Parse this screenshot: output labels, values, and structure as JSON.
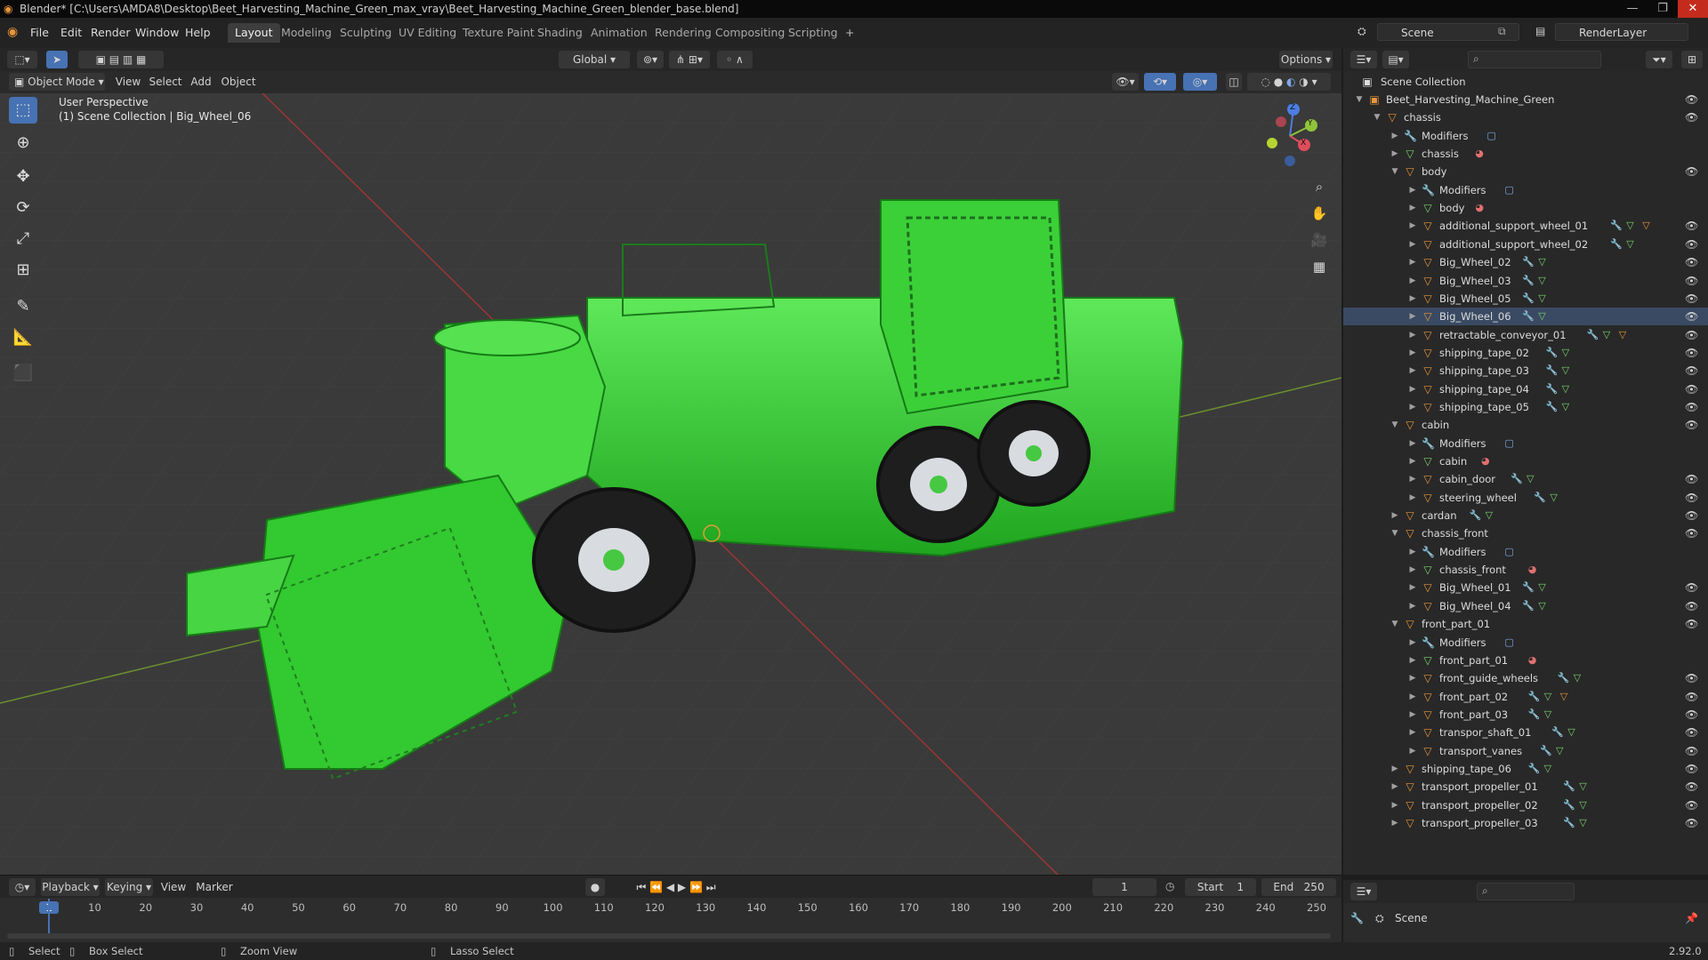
{
  "title_bar": {
    "text": "Blender* [C:\\Users\\AMDA8\\Desktop\\Beet_Harvesting_Machine_Green_max_vray\\Beet_Harvesting_Machine_Green_blender_base.blend]"
  },
  "menus": [
    "File",
    "Edit",
    "Render",
    "Window",
    "Help"
  ],
  "workspaces": [
    "Layout",
    "Modeling",
    "Sculpting",
    "UV Editing",
    "Texture Paint",
    "Shading",
    "Animation",
    "Rendering",
    "Compositing",
    "Scripting"
  ],
  "active_workspace": "Layout",
  "scene_field": "Scene",
  "renderlayer_field": "RenderLayer",
  "header": {
    "transform": "Global",
    "options": "Options"
  },
  "viewport_header": {
    "mode": "Object Mode",
    "items": [
      "View",
      "Select",
      "Add",
      "Object"
    ]
  },
  "viewport": {
    "perspective": "User Perspective",
    "collection": "(1) Scene Collection | Big_Wheel_06",
    "gizmo": {
      "x": "X",
      "y": "Y",
      "z": "Z"
    }
  },
  "outliner": {
    "root": "Scene Collection",
    "rows": [
      {
        "label": "Beet_Harvesting_Machine_Green",
        "depth": 1,
        "icon": "collection",
        "open": true,
        "eye": true
      },
      {
        "label": "chassis",
        "depth": 2,
        "icon": "object",
        "open": true,
        "eye": true
      },
      {
        "label": "Modifiers",
        "depth": 3,
        "icon": "modifier",
        "open": false,
        "eye": false,
        "extra": [
          "mod"
        ]
      },
      {
        "label": "chassis",
        "depth": 3,
        "icon": "mesh",
        "open": false,
        "eye": false,
        "extra": [
          "mat"
        ]
      },
      {
        "label": "body",
        "depth": 3,
        "icon": "object",
        "open": true,
        "eye": true
      },
      {
        "label": "Modifiers",
        "depth": 4,
        "icon": "modifier",
        "open": false,
        "eye": false,
        "extra": [
          "mod"
        ]
      },
      {
        "label": "body",
        "depth": 4,
        "icon": "mesh",
        "open": false,
        "eye": false,
        "extra": [
          "mat"
        ]
      },
      {
        "label": "additional_support_wheel_01",
        "depth": 4,
        "icon": "object",
        "open": false,
        "eye": true,
        "extra": [
          "wrench",
          "mesh",
          "obj"
        ]
      },
      {
        "label": "additional_support_wheel_02",
        "depth": 4,
        "icon": "object",
        "open": false,
        "eye": true,
        "extra": [
          "wrench",
          "mesh"
        ]
      },
      {
        "label": "Big_Wheel_02",
        "depth": 4,
        "icon": "object",
        "open": false,
        "eye": true,
        "extra": [
          "wrench",
          "mesh"
        ]
      },
      {
        "label": "Big_Wheel_03",
        "depth": 4,
        "icon": "object",
        "open": false,
        "eye": true,
        "extra": [
          "wrench",
          "mesh"
        ]
      },
      {
        "label": "Big_Wheel_05",
        "depth": 4,
        "icon": "object",
        "open": false,
        "eye": true,
        "extra": [
          "wrench",
          "mesh"
        ]
      },
      {
        "label": "Big_Wheel_06",
        "depth": 4,
        "icon": "object",
        "open": false,
        "eye": true,
        "extra": [
          "wrench",
          "mesh"
        ],
        "selected": true
      },
      {
        "label": "retractable_conveyor_01",
        "depth": 4,
        "icon": "object",
        "open": false,
        "eye": true,
        "extra": [
          "wrench",
          "mesh",
          "obj"
        ]
      },
      {
        "label": "shipping_tape_02",
        "depth": 4,
        "icon": "object",
        "open": false,
        "eye": true,
        "extra": [
          "wrench",
          "mesh"
        ]
      },
      {
        "label": "shipping_tape_03",
        "depth": 4,
        "icon": "object",
        "open": false,
        "eye": true,
        "extra": [
          "wrench",
          "mesh"
        ]
      },
      {
        "label": "shipping_tape_04",
        "depth": 4,
        "icon": "object",
        "open": false,
        "eye": true,
        "extra": [
          "wrench",
          "mesh"
        ]
      },
      {
        "label": "shipping_tape_05",
        "depth": 4,
        "icon": "object",
        "open": false,
        "eye": true,
        "extra": [
          "wrench",
          "mesh"
        ]
      },
      {
        "label": "cabin",
        "depth": 3,
        "icon": "object",
        "open": true,
        "eye": true
      },
      {
        "label": "Modifiers",
        "depth": 4,
        "icon": "modifier",
        "open": false,
        "eye": false,
        "extra": [
          "mod"
        ]
      },
      {
        "label": "cabin",
        "depth": 4,
        "icon": "mesh",
        "open": false,
        "eye": false,
        "extra": [
          "mat"
        ]
      },
      {
        "label": "cabin_door",
        "depth": 4,
        "icon": "object",
        "open": false,
        "eye": true,
        "extra": [
          "wrench",
          "mesh"
        ]
      },
      {
        "label": "steering_wheel",
        "depth": 4,
        "icon": "object",
        "open": false,
        "eye": true,
        "extra": [
          "wrench",
          "mesh"
        ]
      },
      {
        "label": "cardan",
        "depth": 3,
        "icon": "object",
        "open": false,
        "eye": true,
        "extra": [
          "wrench",
          "mesh"
        ]
      },
      {
        "label": "chassis_front",
        "depth": 3,
        "icon": "object",
        "open": true,
        "eye": true
      },
      {
        "label": "Modifiers",
        "depth": 4,
        "icon": "modifier",
        "open": false,
        "eye": false,
        "extra": [
          "mod"
        ]
      },
      {
        "label": "chassis_front",
        "depth": 4,
        "icon": "mesh",
        "open": false,
        "eye": false,
        "extra": [
          "mat"
        ]
      },
      {
        "label": "Big_Wheel_01",
        "depth": 4,
        "icon": "object",
        "open": false,
        "eye": true,
        "extra": [
          "wrench",
          "mesh"
        ]
      },
      {
        "label": "Big_Wheel_04",
        "depth": 4,
        "icon": "object",
        "open": false,
        "eye": true,
        "extra": [
          "wrench",
          "mesh"
        ]
      },
      {
        "label": "front_part_01",
        "depth": 3,
        "icon": "object",
        "open": true,
        "eye": true
      },
      {
        "label": "Modifiers",
        "depth": 4,
        "icon": "modifier",
        "open": false,
        "eye": false,
        "extra": [
          "mod"
        ]
      },
      {
        "label": "front_part_01",
        "depth": 4,
        "icon": "mesh",
        "open": false,
        "eye": false,
        "extra": [
          "mat"
        ]
      },
      {
        "label": "front_guide_wheels",
        "depth": 4,
        "icon": "object",
        "open": false,
        "eye": true,
        "extra": [
          "wrench",
          "mesh"
        ]
      },
      {
        "label": "front_part_02",
        "depth": 4,
        "icon": "object",
        "open": false,
        "eye": true,
        "extra": [
          "wrench",
          "mesh",
          "obj"
        ]
      },
      {
        "label": "front_part_03",
        "depth": 4,
        "icon": "object",
        "open": false,
        "eye": true,
        "extra": [
          "wrench",
          "mesh"
        ]
      },
      {
        "label": "transpor_shaft_01",
        "depth": 4,
        "icon": "object",
        "open": false,
        "eye": true,
        "extra": [
          "wrench",
          "mesh"
        ]
      },
      {
        "label": "transport_vanes",
        "depth": 4,
        "icon": "object",
        "open": false,
        "eye": true,
        "extra": [
          "wrench",
          "mesh"
        ]
      },
      {
        "label": "shipping_tape_06",
        "depth": 3,
        "icon": "object",
        "open": false,
        "eye": true,
        "extra": [
          "wrench",
          "mesh"
        ]
      },
      {
        "label": "transport_propeller_01",
        "depth": 3,
        "icon": "object",
        "open": false,
        "eye": true,
        "extra": [
          "wrench",
          "mesh"
        ]
      },
      {
        "label": "transport_propeller_02",
        "depth": 3,
        "icon": "object",
        "open": false,
        "eye": true,
        "extra": [
          "wrench",
          "mesh"
        ]
      },
      {
        "label": "transport_propeller_03",
        "depth": 3,
        "icon": "object",
        "open": false,
        "eye": true,
        "extra": [
          "wrench",
          "mesh"
        ]
      }
    ]
  },
  "timeline": {
    "menus": [
      "Playback",
      "Keying",
      "View",
      "Marker"
    ],
    "current_frame": "1",
    "start_label": "Start",
    "start": "1",
    "end_label": "End",
    "end": "250",
    "ticks": [
      "1",
      "10",
      "20",
      "30",
      "40",
      "50",
      "60",
      "70",
      "80",
      "90",
      "100",
      "110",
      "120",
      "130",
      "140",
      "150",
      "160",
      "170",
      "180",
      "190",
      "200",
      "210",
      "220",
      "230",
      "240",
      "250"
    ]
  },
  "properties": {
    "scene_label": "Scene"
  },
  "status": {
    "select": "Select",
    "box_select": "Box Select",
    "zoom_view": "Zoom View",
    "lasso_select": "Lasso Select",
    "version": "2.92.0"
  },
  "colors": {
    "accent": "#4772b3",
    "machine_green": "#3fd23a",
    "object_icon": "#e8953a",
    "mesh_icon": "#7ad36e"
  }
}
